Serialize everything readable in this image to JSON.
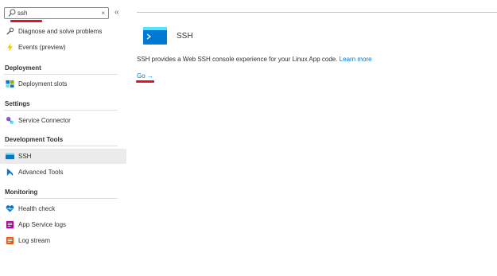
{
  "search": {
    "value": "ssh",
    "clear_glyph": "×"
  },
  "collapse_glyph": "«",
  "sidebar": {
    "items": [
      {
        "label": "Diagnose and solve problems",
        "icon": "wrench-icon"
      },
      {
        "label": "Events (preview)",
        "icon": "lightning-icon"
      }
    ],
    "sections": [
      {
        "title": "Deployment",
        "items": [
          {
            "label": "Deployment slots",
            "icon": "deployment-slots-icon"
          }
        ]
      },
      {
        "title": "Settings",
        "items": [
          {
            "label": "Service Connector",
            "icon": "service-connector-icon"
          }
        ]
      },
      {
        "title": "Development Tools",
        "items": [
          {
            "label": "SSH",
            "icon": "ssh-icon",
            "selected": true
          },
          {
            "label": "Advanced Tools",
            "icon": "advanced-tools-icon"
          }
        ]
      },
      {
        "title": "Monitoring",
        "items": [
          {
            "label": "Health check",
            "icon": "heart-icon"
          },
          {
            "label": "App Service logs",
            "icon": "logs-icon"
          },
          {
            "label": "Log stream",
            "icon": "log-stream-icon"
          }
        ]
      }
    ]
  },
  "main": {
    "title": "SSH",
    "description": "SSH provides a Web SSH console experience for your Linux App code.",
    "learn_more": "Learn more",
    "go_label": "Go →"
  },
  "colors": {
    "accent": "#0078d4",
    "annotation_red": "#e81123",
    "selected_bg": "#ebebeb"
  }
}
